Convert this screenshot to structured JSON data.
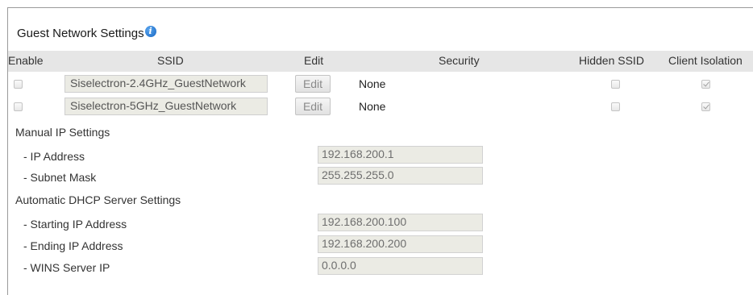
{
  "guest_network": {
    "title": "Guest Network Settings",
    "info_icon": "info-icon",
    "columns": {
      "enable": "Enable",
      "ssid": "SSID",
      "edit": "Edit",
      "security": "Security",
      "hidden_ssid": "Hidden SSID",
      "client_isolation": "Client Isolation"
    },
    "networks": [
      {
        "enabled": false,
        "ssid": "Siselectron-2.4GHz_GuestNetwork",
        "edit_label": "Edit",
        "security": "None",
        "hidden_ssid": false,
        "client_isolation": true
      },
      {
        "enabled": false,
        "ssid": "Siselectron-5GHz_GuestNetwork",
        "edit_label": "Edit",
        "security": "None",
        "hidden_ssid": false,
        "client_isolation": true
      }
    ]
  },
  "manual_ip": {
    "title": "Manual IP Settings",
    "ip_address_label": "- IP Address",
    "ip_address_value": "192.168.200.1",
    "subnet_mask_label": "- Subnet Mask",
    "subnet_mask_value": "255.255.255.0"
  },
  "dhcp": {
    "title": "Automatic DHCP Server Settings",
    "start_ip_label": "- Starting IP Address",
    "start_ip_value": "192.168.200.100",
    "end_ip_label": "- Ending IP Address",
    "end_ip_value": "192.168.200.200",
    "wins_label": "- WINS Server IP",
    "wins_value": "0.0.0.0"
  }
}
